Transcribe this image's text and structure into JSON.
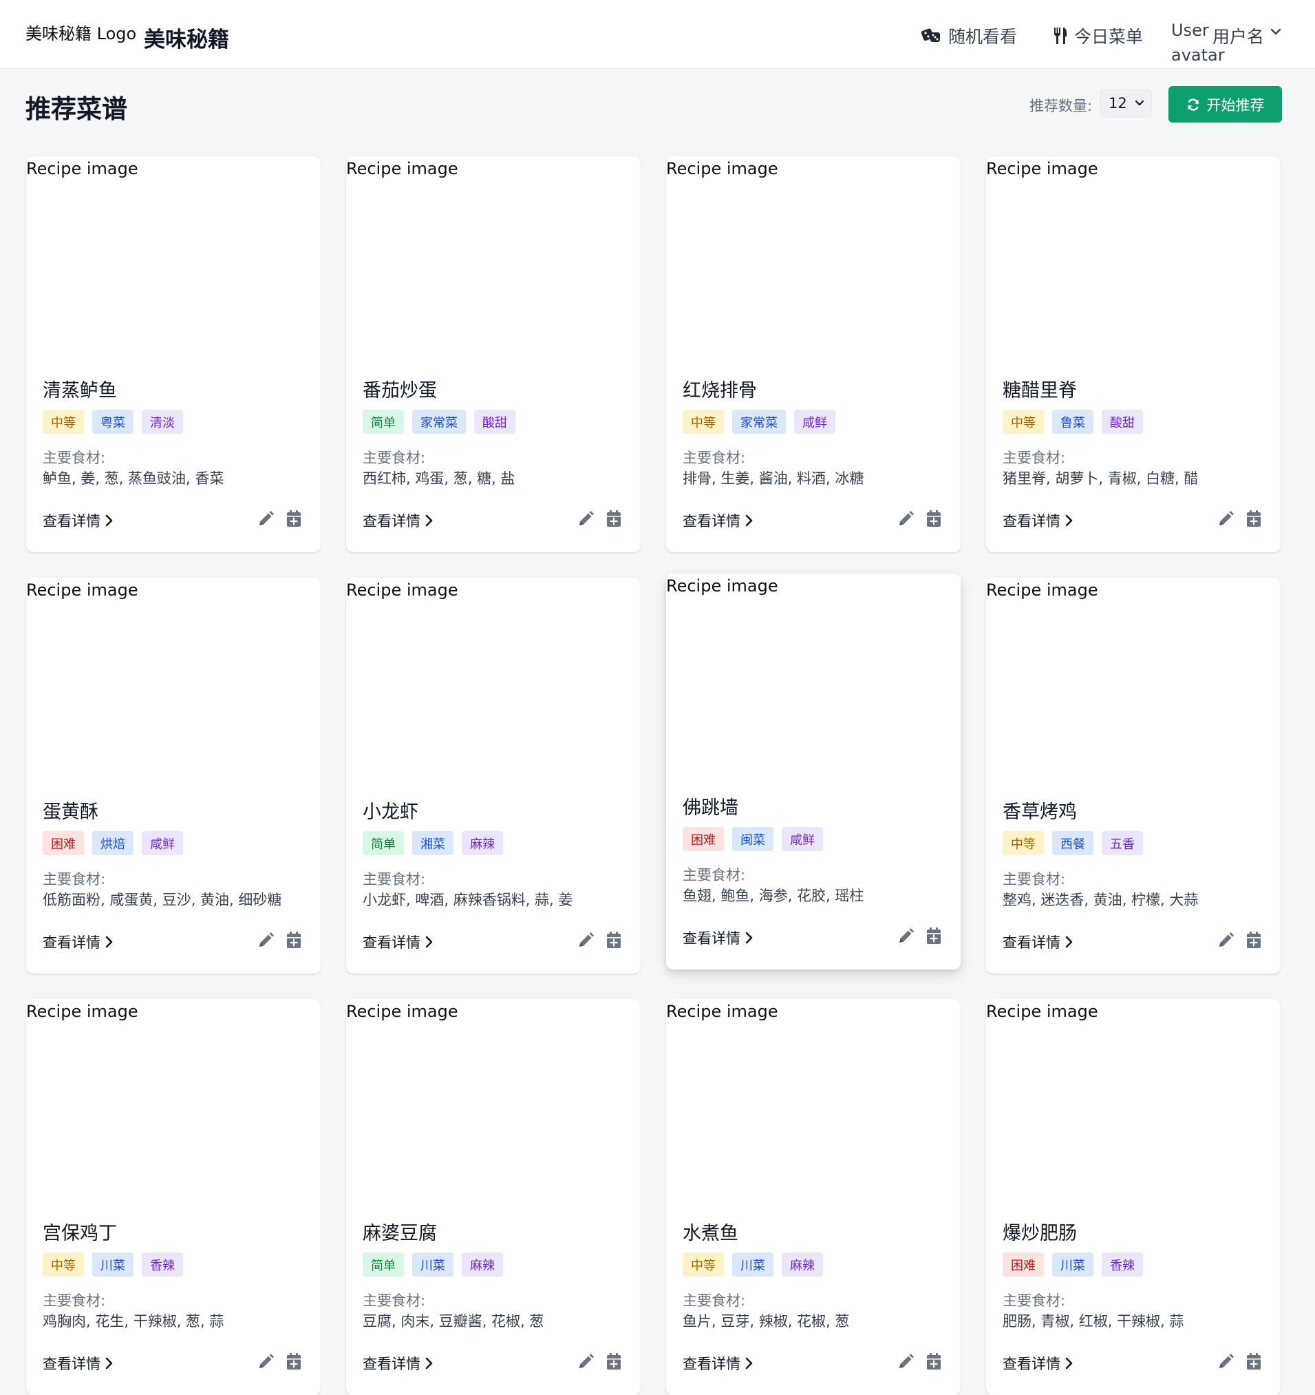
{
  "header": {
    "logo_alt": "美味秘籍 Logo",
    "brand": "美味秘籍",
    "nav_random": "随机看看",
    "nav_menu": "今日菜单",
    "user_alt": "User",
    "user_name": "用户名",
    "user_alt2": "avatar"
  },
  "toolbar": {
    "title": "推荐菜谱",
    "count_label": "推荐数量:",
    "count_value": "12",
    "start_button": "开始推荐"
  },
  "card_labels": {
    "image_alt": "Recipe image",
    "ingredients_label": "主要食材:",
    "detail_link": "查看详情"
  },
  "colors": {
    "accent_green": "#0e9f6e",
    "tag_difficulty_easy": "#d9f7e6",
    "tag_difficulty_medium": "#fdf3c7",
    "tag_difficulty_hard": "#fde2e2",
    "tag_cuisine": "#dbe7fb",
    "tag_flavor": "#ece6fc"
  },
  "icons": {
    "random": "dice-icon",
    "menu": "utensils-icon",
    "user_menu": "chevron-down-icon",
    "start": "refresh-icon",
    "detail": "chevron-right-icon",
    "edit": "pencil-icon",
    "add_to_menu": "calendar-plus-icon"
  },
  "recipes": [
    {
      "name": "清蒸鲈鱼",
      "difficulty": "中等",
      "cuisine": "粤菜",
      "flavor": "清淡",
      "ingredients": "鲈鱼, 姜, 葱, 蒸鱼豉油, 香菜"
    },
    {
      "name": "番茄炒蛋",
      "difficulty": "简单",
      "cuisine": "家常菜",
      "flavor": "酸甜",
      "ingredients": "西红柿, 鸡蛋, 葱, 糖, 盐"
    },
    {
      "name": "红烧排骨",
      "difficulty": "中等",
      "cuisine": "家常菜",
      "flavor": "咸鲜",
      "ingredients": "排骨, 生姜, 酱油, 料酒, 冰糖"
    },
    {
      "name": "糖醋里脊",
      "difficulty": "中等",
      "cuisine": "鲁菜",
      "flavor": "酸甜",
      "ingredients": "猪里脊, 胡萝卜, 青椒, 白糖, 醋"
    },
    {
      "name": "蛋黄酥",
      "difficulty": "困难",
      "cuisine": "烘焙",
      "flavor": "咸鲜",
      "ingredients": "低筋面粉, 咸蛋黄, 豆沙, 黄油, 细砂糖"
    },
    {
      "name": "小龙虾",
      "difficulty": "简单",
      "cuisine": "湘菜",
      "flavor": "麻辣",
      "ingredients": "小龙虾, 啤酒, 麻辣香锅料, 蒜, 姜"
    },
    {
      "name": "佛跳墙",
      "difficulty": "困难",
      "cuisine": "闽菜",
      "flavor": "咸鲜",
      "ingredients": "鱼翅, 鲍鱼, 海参, 花胶, 瑶柱"
    },
    {
      "name": "香草烤鸡",
      "difficulty": "中等",
      "cuisine": "西餐",
      "flavor": "五香",
      "ingredients": "整鸡, 迷迭香, 黄油, 柠檬, 大蒜"
    },
    {
      "name": "宫保鸡丁",
      "difficulty": "中等",
      "cuisine": "川菜",
      "flavor": "香辣",
      "ingredients": "鸡胸肉, 花生, 干辣椒, 葱, 蒜"
    },
    {
      "name": "麻婆豆腐",
      "difficulty": "简单",
      "cuisine": "川菜",
      "flavor": "麻辣",
      "ingredients": "豆腐, 肉末, 豆瓣酱, 花椒, 葱"
    },
    {
      "name": "水煮鱼",
      "difficulty": "中等",
      "cuisine": "川菜",
      "flavor": "麻辣",
      "ingredients": "鱼片, 豆芽, 辣椒, 花椒, 葱"
    },
    {
      "name": "爆炒肥肠",
      "difficulty": "困难",
      "cuisine": "川菜",
      "flavor": "香辣",
      "ingredients": "肥肠, 青椒, 红椒, 干辣椒, 蒜"
    }
  ]
}
